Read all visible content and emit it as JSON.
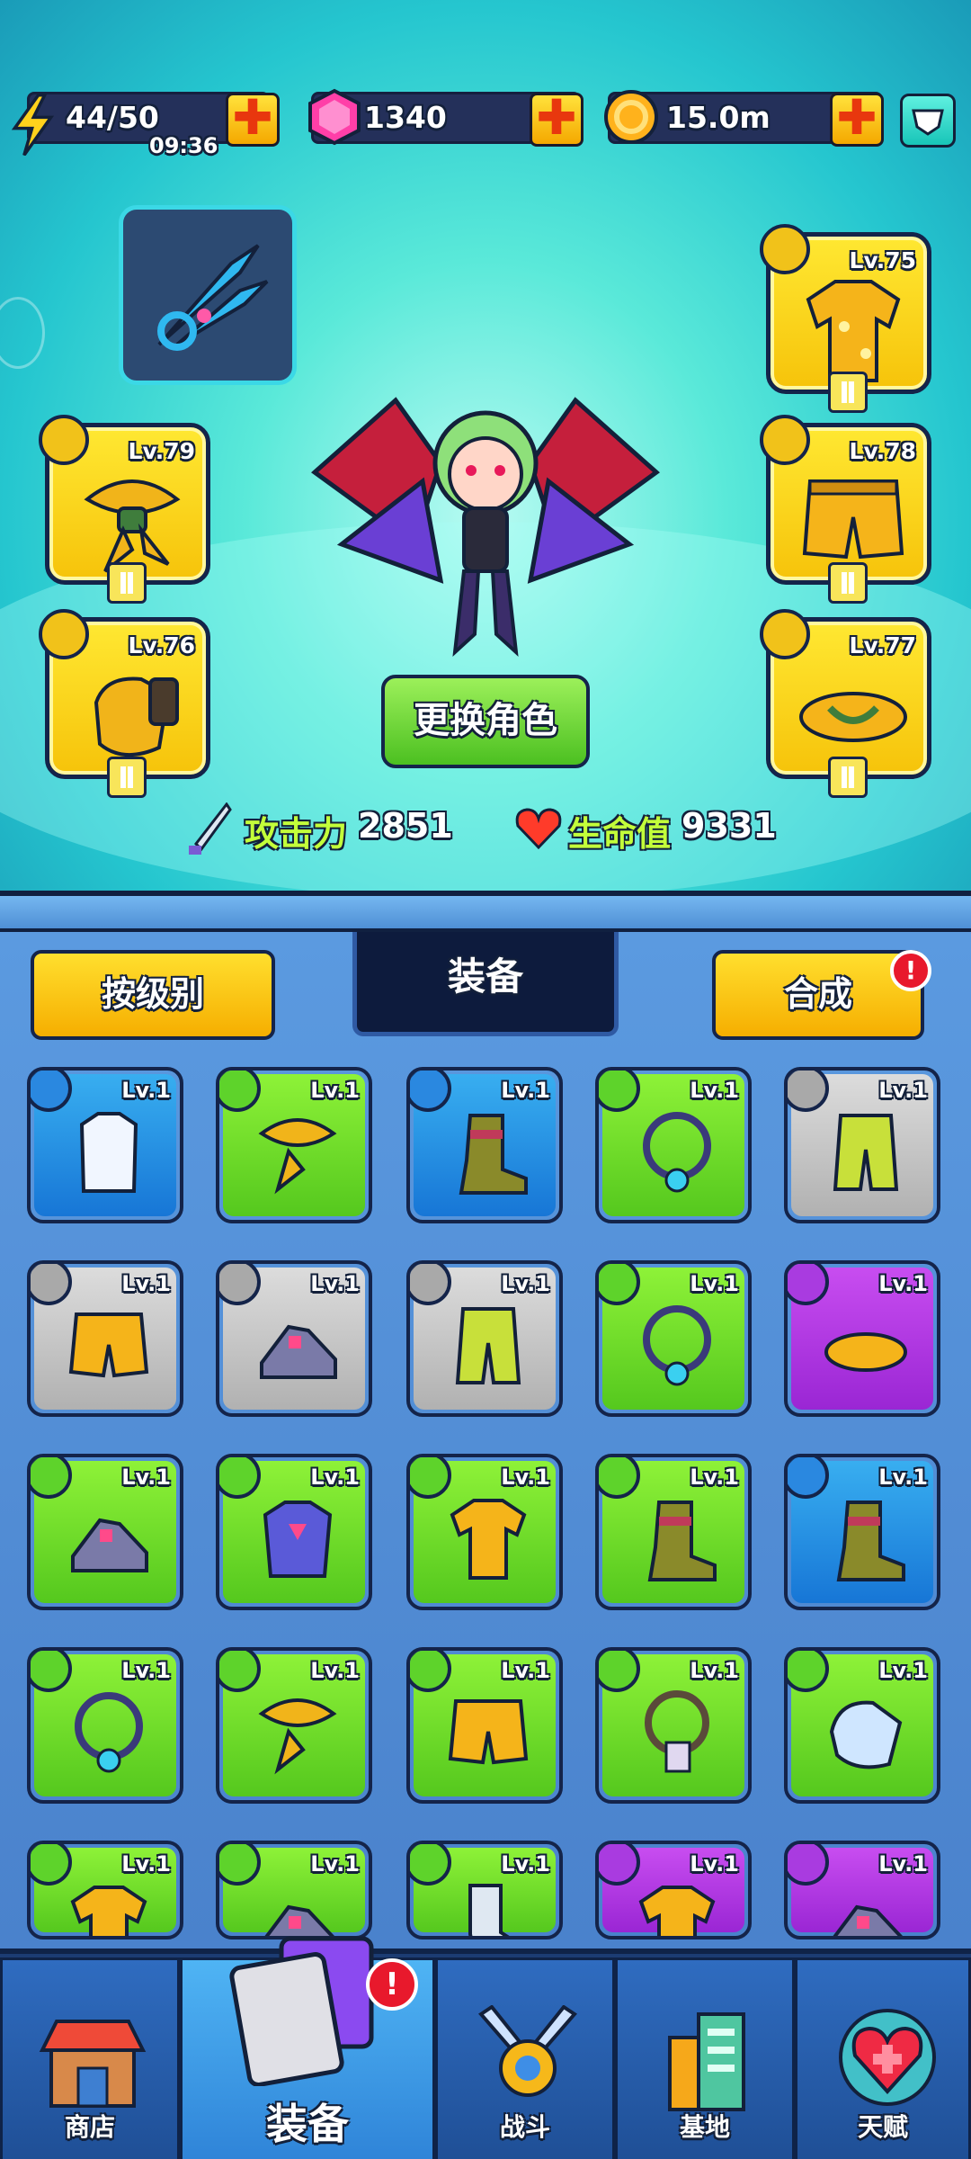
{
  "resources": {
    "energy": {
      "value": "44/50",
      "timer": "09:36",
      "icon": "lightning-icon"
    },
    "gems": {
      "value": "1340",
      "icon": "gem-icon"
    },
    "coins": {
      "value": "15.0m",
      "icon": "coin-icon"
    },
    "plus_glyph": "✚"
  },
  "hero": {
    "swap_button": "更换角色",
    "attack_label": "攻击力",
    "attack_value": "2851",
    "hp_label": "生命值",
    "hp_value": "9331",
    "slots": [
      {
        "level": "Lv.79",
        "item": "scarf"
      },
      {
        "level": "Lv.76",
        "item": "gloves"
      },
      {
        "level": "Lv.75",
        "item": "hawaiian-shirt"
      },
      {
        "level": "Lv.78",
        "item": "shorts"
      },
      {
        "level": "Lv.77",
        "item": "flip-flops"
      }
    ]
  },
  "inventory": {
    "sort_button": "按级别",
    "tab_title": "装备",
    "merge_button": "合成",
    "alert_glyph": "!",
    "level_label": "Lv.1"
  },
  "nav": {
    "shop": "商店",
    "equip": "装备",
    "battle": "战斗",
    "base": "基地",
    "talent": "天赋"
  },
  "colors": {
    "green": "#6ee02c",
    "blue": "#2a8ee6",
    "gray": "#c4c4c4",
    "purple": "#b23de6",
    "gold": "#f8d21c"
  }
}
